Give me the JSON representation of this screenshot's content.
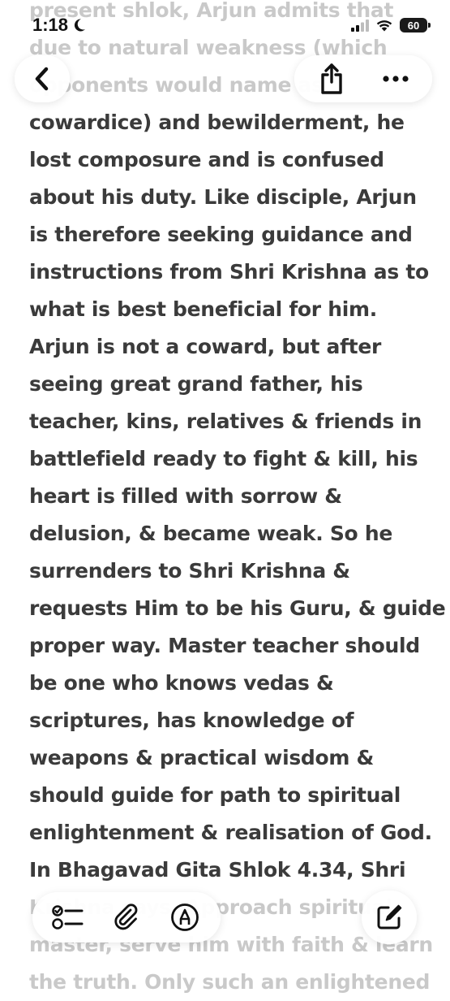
{
  "status_bar": {
    "time": "1:18",
    "battery": "60",
    "icons": [
      "moon-icon",
      "signal-icon",
      "wifi-icon",
      "battery-icon"
    ]
  },
  "toolbar": {
    "back_icon": "chevron-left-icon",
    "share_icon": "share-icon",
    "more_icon": "more-icon"
  },
  "bottom_toolbar": {
    "checklist_icon": "checklist-icon",
    "attachment_icon": "paperclip-icon",
    "markup_icon": "markup-pen-icon",
    "compose_icon": "compose-icon"
  },
  "note": {
    "lines": [
      "present shlok, Arjun admits that",
      "due to natural weakness (which",
      "opponents would name as",
      "cowardice) and bewilderment, he",
      "lost composure and is confused",
      "about his duty. Like disciple, Arjun",
      "is therefore seeking guidance and",
      "instructions from Shri Krishna as to",
      "what is best beneficial for him.",
      "Arjun is not a coward, but after",
      "seeing great grand father, his",
      "teacher, kins, relatives & friends in",
      "battlefield ready to fight & kill, his",
      "heart is filled with sorrow &",
      "delusion, & became weak. So he",
      "surrenders to Shri Krishna &",
      "requests Him to be his Guru, & guide",
      "proper way. Master teacher should",
      "be one who knows vedas &",
      "scriptures, has knowledge of",
      "weapons & practical wisdom &",
      "should guide for path to spiritual",
      "enlightenment & realisation of God.",
      "In Bhagavad Gita Shlok 4.34, Shri",
      "Krishna says, Approach spiritual",
      "master, serve him with faith & learn",
      "the truth. Only such an enlightened"
    ]
  },
  "colors": {
    "text": "#3b3b3b",
    "faded_text": "#c9c9c9",
    "background": "#ffffff",
    "icon": "#111111"
  }
}
